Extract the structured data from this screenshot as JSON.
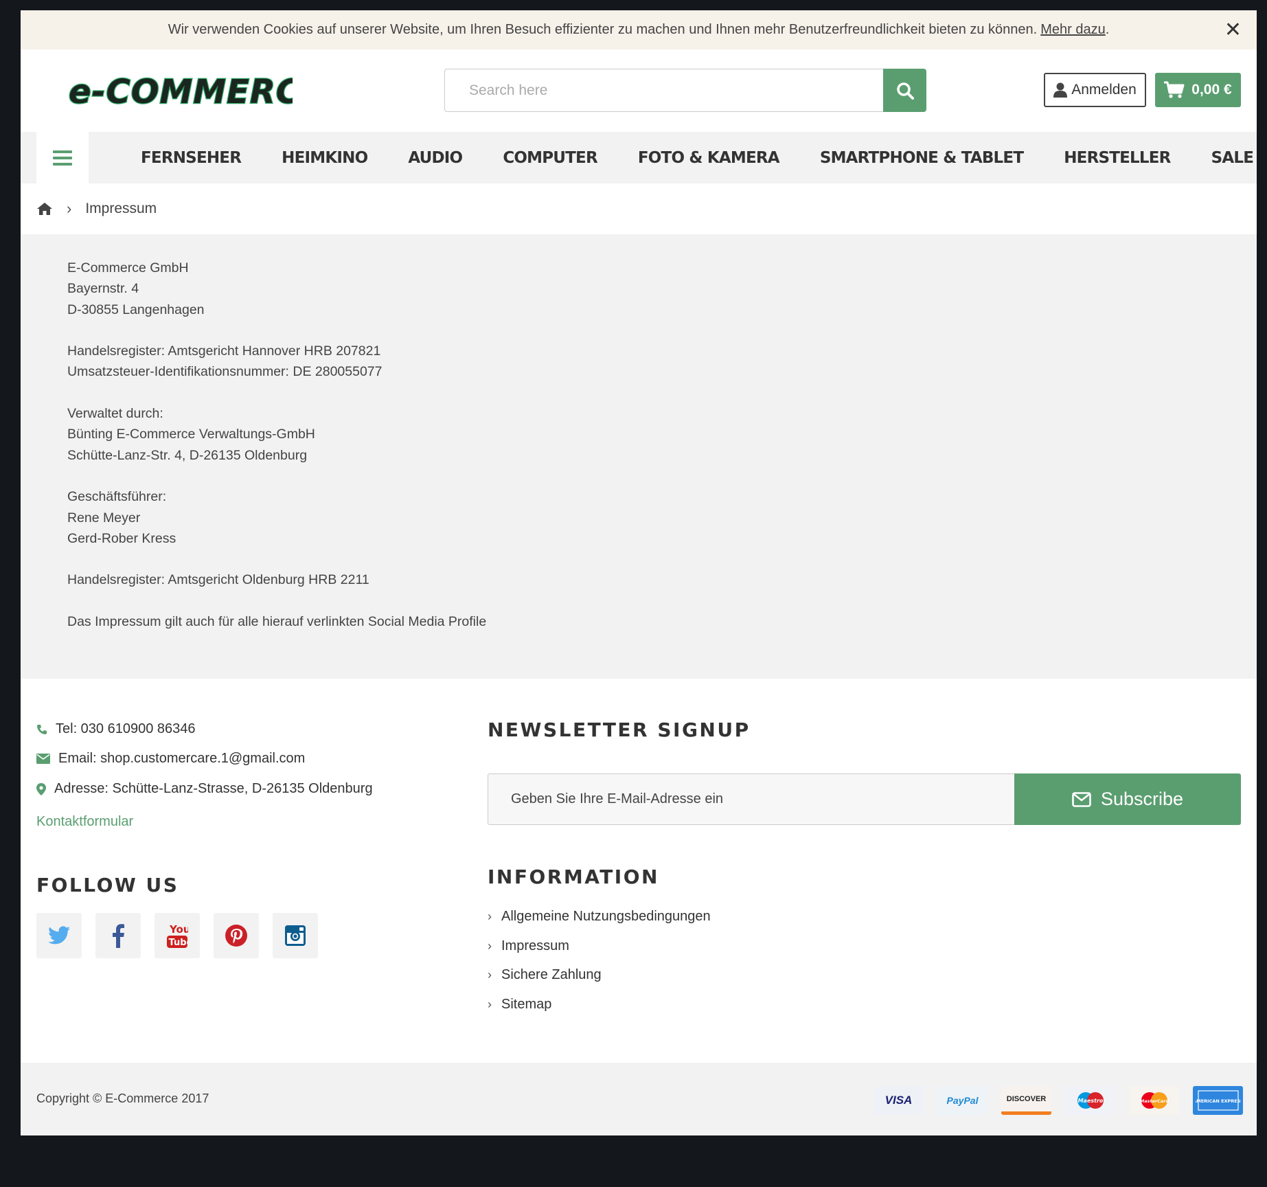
{
  "cookie": {
    "text": "Wir verwenden Cookies auf unserer Website, um Ihren Besuch effizienter zu machen und Ihnen mehr Benutzerfreundlichkeit bieten zu können.",
    "link": "Mehr dazu",
    "link_suffix": ".",
    "close_label": "✕"
  },
  "header": {
    "logo_text": "e-COMMERCE",
    "search_placeholder": "Search here",
    "login_label": "Anmelden",
    "cart_total": "0,00 €"
  },
  "nav": {
    "items": [
      "FERNSEHER",
      "HEIMKINO",
      "AUDIO",
      "COMPUTER",
      "FOTO & KAMERA",
      "SMARTPHONE & TABLET",
      "HERSTELLER",
      "SALE"
    ]
  },
  "breadcrumb": {
    "current": "Impressum"
  },
  "content": {
    "lines": [
      "E-Commerce GmbH",
      "Bayernstr. 4",
      "D-30855 Langenhagen",
      "",
      "Handelsregister: Amtsgericht Hannover HRB 207821",
      "Umsatzsteuer-Identifikationsnummer: DE 280055077",
      "",
      "Verwaltet durch:",
      "Bünting E-Commerce Verwaltungs-GmbH",
      "Schütte-Lanz-Str. 4, D-26135 Oldenburg",
      "",
      "Geschäftsführer:",
      "Rene Meyer",
      "Gerd-Rober Kress",
      "",
      "Handelsregister: Amtsgericht Oldenburg HRB 2211",
      "",
      "Das Impressum gilt auch für alle hierauf verlinkten Social Media Profile"
    ]
  },
  "footer": {
    "tel": "Tel: 030 610900 86346",
    "email": "Email: shop.customercare.1@gmail.com",
    "address": "Adresse: Schütte-Lanz-Strasse, D-26135 Oldenburg",
    "contact_link": "Kontaktformular",
    "follow_title": "FOLLOW US",
    "social": [
      "twitter-icon",
      "facebook-icon",
      "youtube-icon",
      "pinterest-icon",
      "instagram-icon"
    ],
    "newsletter_title": "NEWSLETTER SIGNUP",
    "newsletter_placeholder": "Geben Sie Ihre E-Mail-Adresse ein",
    "subscribe_label": "Subscribe",
    "information_title": "INFORMATION",
    "information_links": [
      "Allgemeine Nutzungsbedingungen",
      "Impressum",
      "Sichere Zahlung",
      "Sitemap"
    ],
    "copyright": "Copyright © E-Commerce 2017",
    "payments": [
      "VISA",
      "PayPal",
      "DISCOVER",
      "Maestro",
      "MasterCard",
      "AMERICAN EXPRESS"
    ]
  },
  "colors": {
    "accent": "#5a9e70",
    "cookie_bg": "#f6f1e9",
    "nav_bg": "#f2f2f2",
    "outer_bg": "#14171c"
  }
}
